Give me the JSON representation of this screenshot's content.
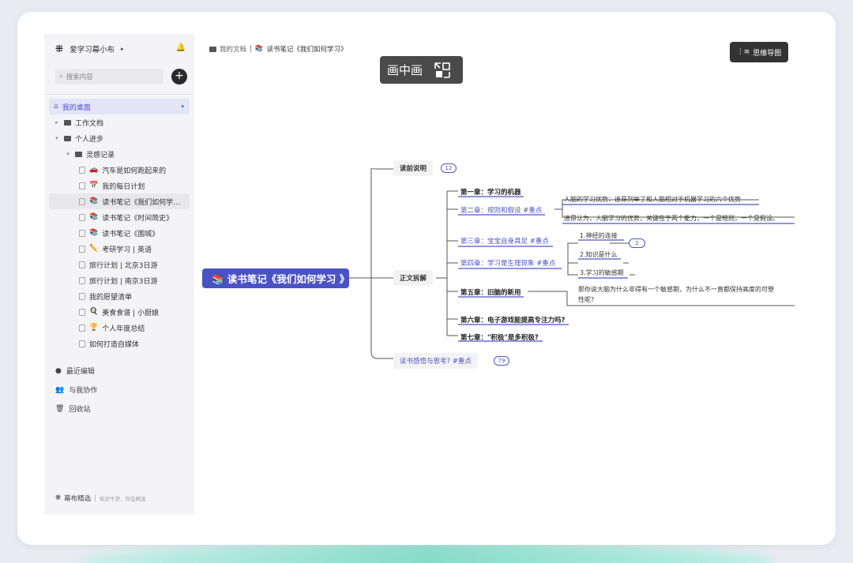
{
  "sidebar": {
    "logo": "⁜",
    "workspace": "爱学习幕小布",
    "workspace_caret": "▸",
    "bell": "🔔",
    "search_placeholder": "搜索内容",
    "add": "+",
    "desk_label": "我的桌面",
    "desk_caret": "▾",
    "tree": [
      {
        "label": "工作文档"
      },
      {
        "label": "个人进步"
      },
      {
        "label": "灵感记录"
      },
      {
        "icon": "🚗",
        "label": "汽车是如何跑起来的"
      },
      {
        "icon": "📅",
        "label": "我的每日计划"
      },
      {
        "icon": "📚",
        "label": "读书笔记《我们如何学..."
      },
      {
        "icon": "📚",
        "label": "读书笔记《时间简史》"
      },
      {
        "icon": "📚",
        "label": "读书笔记《围城》"
      },
      {
        "icon": "✏️",
        "label": "考研学习 | 英语"
      },
      {
        "label": "旅行计划 | 北京3日游"
      },
      {
        "label": "旅行计划 | 南京3日游"
      },
      {
        "label": "我的愿望清单"
      },
      {
        "icon": "🍳",
        "label": "美食食谱 | 小厨娘"
      },
      {
        "icon": "🏆",
        "label": "个人年度总结"
      },
      {
        "label": "如何打造自媒体"
      }
    ],
    "nav": [
      {
        "icon": "●",
        "label": "最近编辑"
      },
      {
        "icon": "👥",
        "label": "与我协作"
      },
      {
        "icon": "🗑",
        "label": "回收站"
      }
    ],
    "footer": {
      "brand": "幕布精选",
      "sub": "知识干货，尽在精选"
    }
  },
  "breadcrumb": {
    "root": "我的文档",
    "sep": "|",
    "current": "读书笔记《我们如何学习》"
  },
  "pip_label": "画中画",
  "mindmap_button": "思维导图",
  "mindmap": {
    "root": "📚 读书笔记《我们如何学习 》",
    "pre": "读前说明",
    "pre_count": "12",
    "body": "正文拆解",
    "reflection": "读书感悟与思考? #重点",
    "reflection_count": "79",
    "chapters": [
      "第一章：学习的机器",
      "第二章：规则和假设 #重点",
      "第三章：宝宝自身具足 #重点",
      "第四章：学习是生理现象 #重点",
      "第五章：旧脑的新用",
      "第六章：电子游戏能提高专注力吗?",
      "第七章：\"积极\"是多积极?"
    ],
    "ch2_notes": [
      "人脑的学习优势：迪昂列举了和人脑相对于机器学习的六个优势",
      "迪昂认为，人脑学习的优势，关键在于两个能力，一个是规则，一个是假设。"
    ],
    "ch4_items": [
      "1.神经的连接",
      "2.知识是什么",
      "3.学习的敏感期"
    ],
    "ch4_count": "2",
    "ch5_note_line1": "那你说大脑为什么非得有一个敏感期，为什么不一直都保持高度的可塑",
    "ch5_note_line2": "性呢?"
  }
}
